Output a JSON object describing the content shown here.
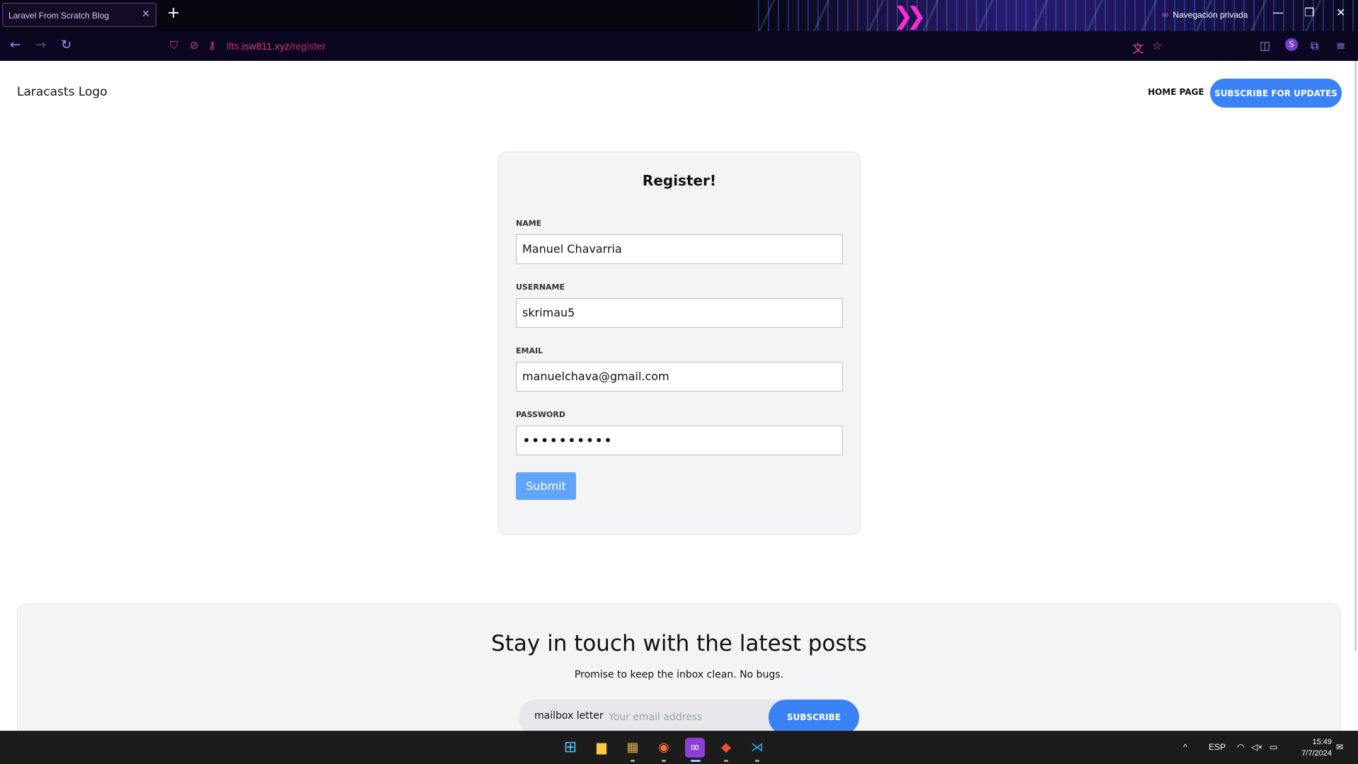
{
  "browser": {
    "tab_title": "Laravel From Scratch Blog",
    "tab_close": "✕",
    "new_tab": "+",
    "private_label": "Navegación privada",
    "url_prefix": "lfts.",
    "url_host": "isw811.xyz",
    "url_path": "/register",
    "profile_initial": "S"
  },
  "site": {
    "logo": "Laracasts Logo",
    "nav_home": "HOME PAGE",
    "nav_subscribe": "SUBSCRIBE FOR UPDATES"
  },
  "register": {
    "title": "Register!",
    "fields": [
      {
        "label": "NAME",
        "value": "Manuel Chavarria"
      },
      {
        "label": "USERNAME",
        "value": "skrimau5"
      },
      {
        "label": "EMAIL",
        "value": "manuelchava@gmail.com"
      },
      {
        "label": "PASSWORD",
        "value": "••••••••••"
      }
    ],
    "submit": "Submit"
  },
  "newsletter": {
    "title": "Stay in touch with the latest posts",
    "subtitle": "Promise to keep the inbox clean. No bugs.",
    "label": "mailbox letter",
    "placeholder": "Your email address",
    "button": "SUBSCRIBE"
  },
  "taskbar": {
    "language": "ESP",
    "time": "15:49",
    "date": "7/7/2024"
  },
  "colors": {
    "accent": "#3b82f6",
    "submit": "#60a5fa",
    "card_bg": "#f3f4f6",
    "url_pink": "#e0357f",
    "chrome_bg": "#07050f"
  }
}
